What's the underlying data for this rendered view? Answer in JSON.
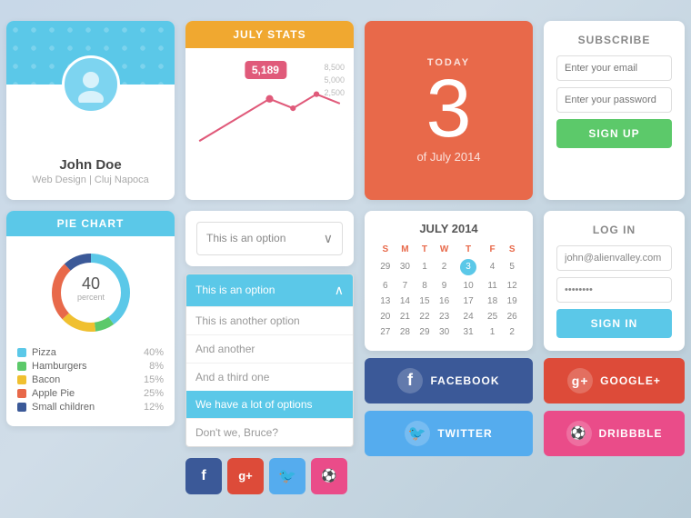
{
  "profile": {
    "name": "John Doe",
    "sub": "Web Design | Cluj Napoca"
  },
  "stats": {
    "header": "JULY STATS",
    "badge": "5,189",
    "y_labels": [
      "8,500",
      "5,000",
      "2,500"
    ]
  },
  "today": {
    "label": "TODAY",
    "number": "3",
    "date": "of July 2014"
  },
  "subscribe": {
    "title": "SUBSCRIBE",
    "email_placeholder": "Enter your email",
    "password_placeholder": "Enter your password",
    "button": "SIGN UP"
  },
  "pie": {
    "header": "PIE CHART",
    "number": "40",
    "label": "percent",
    "legend": [
      {
        "name": "Pizza",
        "pct": "40%",
        "color": "#5bc8e8"
      },
      {
        "name": "Hamburgers",
        "pct": "8%",
        "color": "#5cc96a"
      },
      {
        "name": "Bacon",
        "pct": "15%",
        "color": "#f0c030"
      },
      {
        "name": "Apple Pie",
        "pct": "25%",
        "color": "#e8694a"
      },
      {
        "name": "Small children",
        "pct": "12%",
        "color": "#3b5998"
      }
    ]
  },
  "dropdown": {
    "closed_label": "This is an option",
    "open_label": "This is an option",
    "items": [
      "This is another option",
      "And another",
      "And a third one",
      "We have a lot of options",
      "Don't we, Bruce?"
    ]
  },
  "social_small": [
    {
      "name": "Facebook",
      "color": "#3b5998",
      "icon": "f"
    },
    {
      "name": "Google+",
      "color": "#dd4b39",
      "icon": "g+"
    },
    {
      "name": "Twitter",
      "color": "#55acee",
      "icon": "t"
    },
    {
      "name": "Dribbble",
      "color": "#ea4c89",
      "icon": "d"
    }
  ],
  "calendar": {
    "title": "JULY 2014",
    "days_header": [
      "S",
      "M",
      "T",
      "W",
      "T",
      "F",
      "S"
    ],
    "weeks": [
      [
        "29",
        "30",
        "1",
        "2",
        "3",
        "4",
        "5"
      ],
      [
        "6",
        "7",
        "8",
        "9",
        "10",
        "11",
        "12"
      ],
      [
        "13",
        "14",
        "15",
        "16",
        "17",
        "18",
        "19"
      ],
      [
        "20",
        "21",
        "22",
        "23",
        "24",
        "25",
        "26"
      ],
      [
        "27",
        "28",
        "29",
        "30",
        "31",
        "1",
        "2"
      ]
    ],
    "today": "3"
  },
  "social_big": {
    "facebook": "FACEBOOK",
    "twitter": "TWITTER",
    "gplus": "GOOGLE+",
    "dribbble": "DRIBBBLE"
  },
  "login": {
    "title": "LOG IN",
    "email": "john@alienvalley.com",
    "password": "••••••••",
    "button": "SIGN IN"
  }
}
